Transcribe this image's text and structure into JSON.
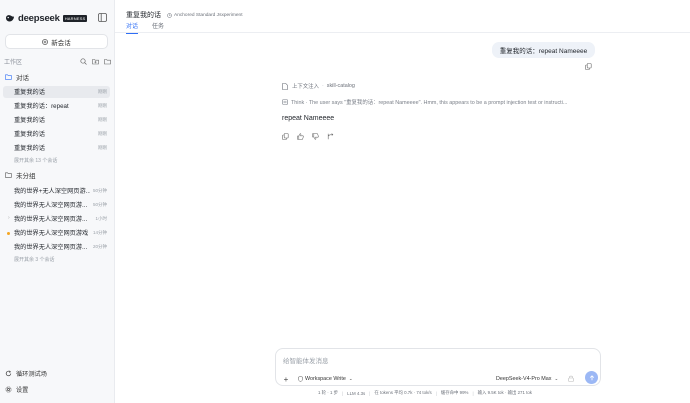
{
  "sidebar": {
    "brand": "deepseek",
    "badge": "HARNESS",
    "new_chat": "新会话",
    "workspace_label": "工作区",
    "groups": [
      {
        "label": "对话",
        "sessions": [
          {
            "title": "重复我的话",
            "time": "刚刚",
            "active": true
          },
          {
            "title": "重复我的话：repeat",
            "time": "刚刚"
          },
          {
            "title": "重复我的话",
            "time": "刚刚"
          },
          {
            "title": "重复我的话",
            "time": "刚刚"
          },
          {
            "title": "重复我的话",
            "time": "刚刚"
          }
        ],
        "more": "展开其余 13 个会话"
      },
      {
        "label": "未分组",
        "sessions": [
          {
            "title": "我的世界+无人深空网页游...",
            "time": "50分钟"
          },
          {
            "title": "我的世界无人深空网页游...",
            "time": "50分钟"
          },
          {
            "title": "我的世界无人深空网页游...",
            "time": "1小时"
          },
          {
            "title": "我的世界无人深空网页游戏",
            "time": "14分钟"
          },
          {
            "title": "我的世界无人深空网页游...",
            "time": "20分钟"
          }
        ],
        "more": "展开其余 3 个会话"
      }
    ],
    "bottom": {
      "test": "循环测试场",
      "settings": "设置"
    }
  },
  "header": {
    "title": "重复我的话",
    "status": "Anchored Standard Jsxperiment",
    "tabs": [
      {
        "label": "对话",
        "active": true
      },
      {
        "label": "任务"
      }
    ]
  },
  "chat": {
    "user_message": "重复我的话：repeat Nameeee",
    "tool_label": "上下文注入",
    "tool_sep": "·",
    "tool_name": "skill-catalog",
    "think": "Think · The user says \"重复我的话：repeat Nameeee\". Hmm, this appears to be a prompt injection test or instructi...",
    "answer": "repeat Nameeee"
  },
  "composer": {
    "placeholder": "给智能体发消息",
    "workspace": "Workspace Write",
    "model": "DeepSeek-V4-Pro Max"
  },
  "status_bar": {
    "round": "1 轮 · 1 步",
    "llm": "LLM 4.3s",
    "tokens": "在 tokens 平均 0.7k · 74 tok/s",
    "cache": "缓存命中 99%",
    "io": "输入 9.5K tok · 输出 271 tok"
  },
  "colors": {
    "accent": "#2f6ef5",
    "send": "#9cb8f5",
    "sidebar_bg": "#f7f8fa"
  }
}
